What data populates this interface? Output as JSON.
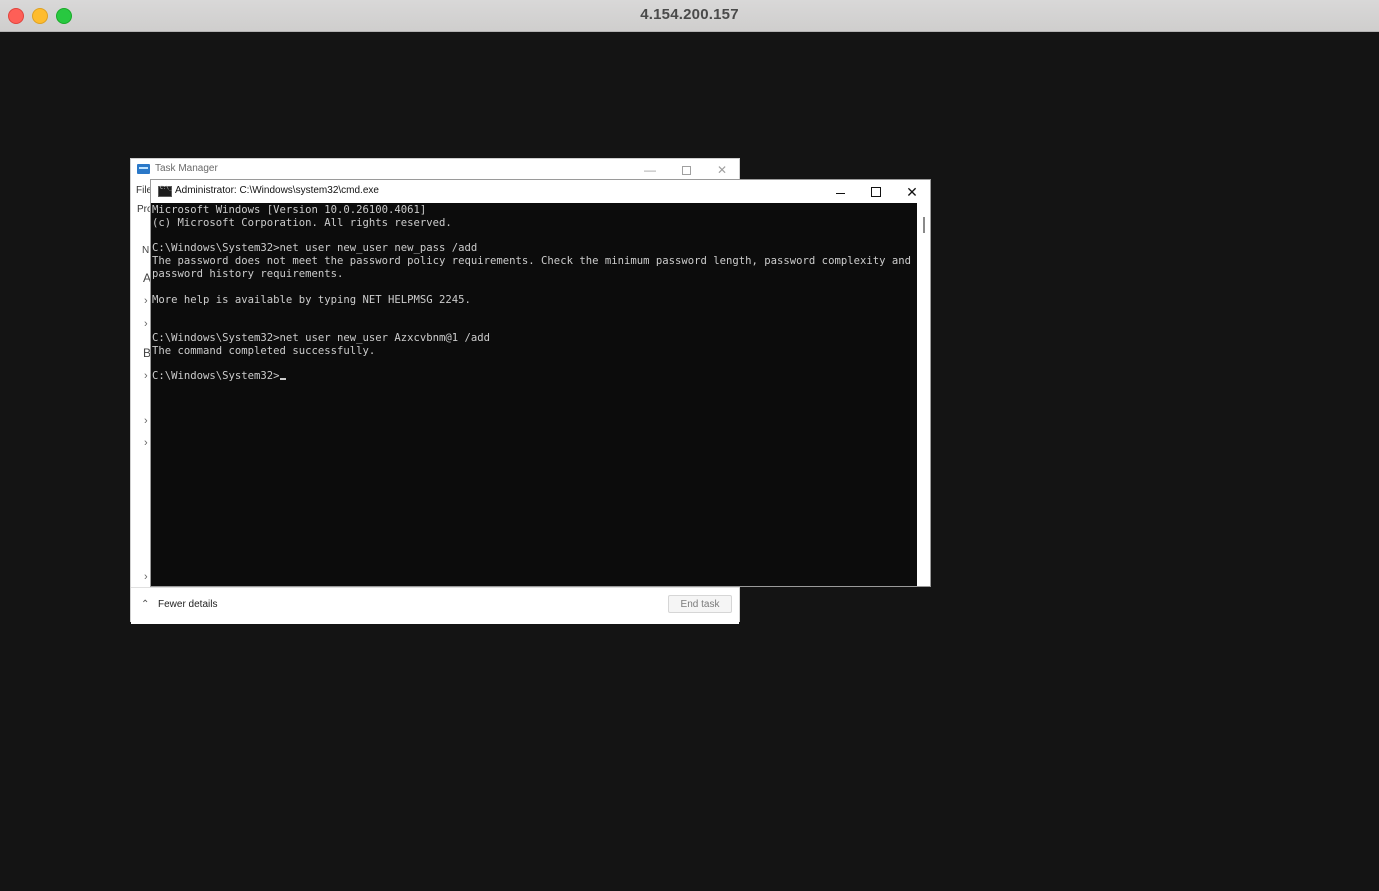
{
  "mac_window": {
    "title": "4.154.200.157"
  },
  "task_manager": {
    "title": "Task Manager",
    "menu_fragment": "File",
    "tab_fragment": "Pro",
    "left_letters": [
      "N",
      "A",
      "B"
    ],
    "footer": {
      "fewer_details_label": "Fewer details",
      "end_task_label": "End task"
    }
  },
  "cmd": {
    "title": "Administrator: C:\\Windows\\system32\\cmd.exe",
    "output": "Microsoft Windows [Version 10.0.26100.4061]\n(c) Microsoft Corporation. All rights reserved.\n\nC:\\Windows\\System32>net user new_user new_pass /add\nThe password does not meet the password policy requirements. Check the minimum password length, password complexity and\npassword history requirements.\n\nMore help is available by typing NET HELPMSG 2245.\n\n\nC:\\Windows\\System32>net user new_user Azxcvbnm@1 /add\nThe command completed successfully.\n\n",
    "prompt": "C:\\Windows\\System32>"
  },
  "colors": {
    "desktop_bg": "#141414",
    "console_bg": "#0c0c0c",
    "console_text": "#cccccc"
  }
}
